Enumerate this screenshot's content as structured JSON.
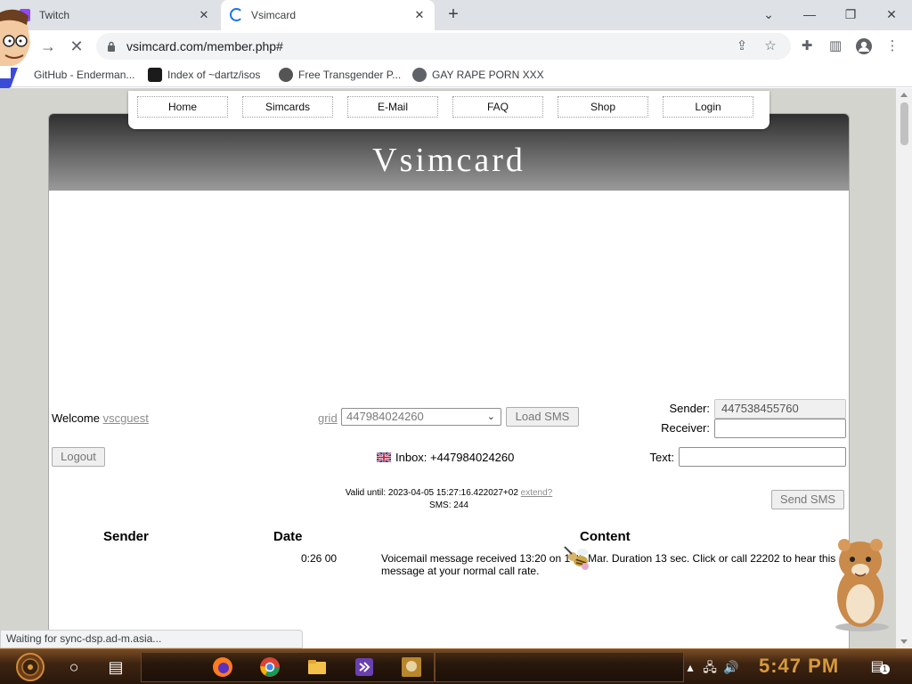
{
  "browser": {
    "tabs": [
      {
        "title": "Twitch",
        "active": false
      },
      {
        "title": "Vsimcard",
        "active": true
      }
    ],
    "url": "vsimcard.com/member.php#",
    "bookmarks": [
      {
        "label": "GitHub - Enderman...",
        "icon": "github-icon"
      },
      {
        "label": "Index of ~dartz/isos",
        "icon": "index-icon"
      },
      {
        "label": "Free Transgender P...",
        "icon": "bookmark-site-icon"
      },
      {
        "label": "GAY RAPE PORN XXX",
        "icon": "globe-icon"
      }
    ],
    "status_text": "Waiting for sync-dsp.ad-m.asia..."
  },
  "site": {
    "title": "Vsimcard",
    "menu": [
      "Home",
      "Simcards",
      "E-Mail",
      "FAQ",
      "Shop",
      "Login"
    ],
    "welcome_label": "Welcome",
    "username": "vscguest",
    "logout_label": "Logout",
    "grid_label": "grid",
    "grid_selected": "447984024260",
    "load_sms_label": "Load SMS",
    "sender_label": "Sender:",
    "sender_value": "447538455760",
    "receiver_label": "Receiver:",
    "receiver_value": "",
    "text_label": "Text:",
    "text_value": "",
    "send_sms_label": "Send SMS",
    "inbox_text": "Inbox: +447984024260",
    "valid_until_text": "Valid until: 2023-04-05 15:27:16.422027+02",
    "extend_label": "extend?",
    "sms_count_text": "SMS: 244",
    "table": {
      "headers": [
        "Sender",
        "Date",
        "Content"
      ],
      "rows": [
        {
          "date": "0:26 00",
          "content": "Voicemail message received 13:20 on 14th Mar. Duration 13 sec. Click or call 22202 to hear this message at your normal call rate."
        }
      ]
    }
  },
  "taskbar": {
    "clock": "5:47 PM",
    "notification_count": "1"
  },
  "colors": {
    "header_dark": "#2f2f2f",
    "header_light": "#9a9a9a",
    "clock": "#d89a3a",
    "taskbar": "#3e2512"
  }
}
